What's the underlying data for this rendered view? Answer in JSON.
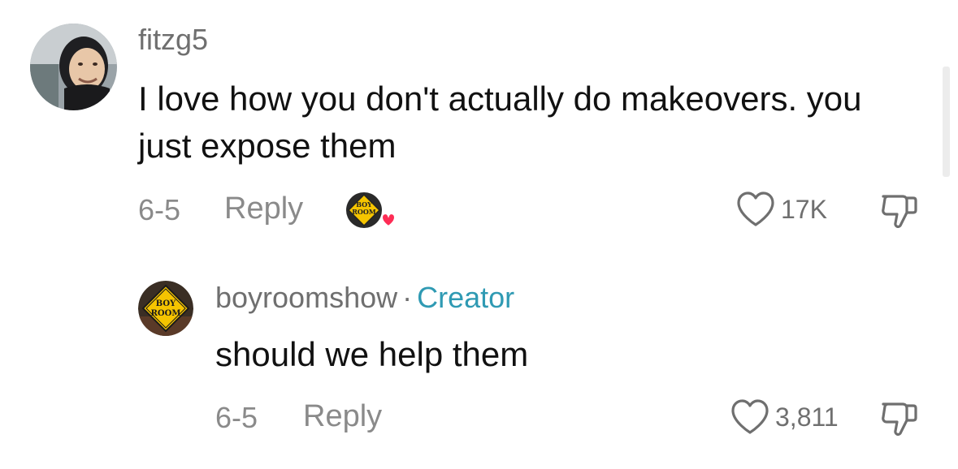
{
  "comment": {
    "username": "fitzg5",
    "text": "I love how you don't actually do makeovers. you just expose them",
    "date": "6-5",
    "reply_label": "Reply",
    "like_count": "17K",
    "avatar_icon": "user-avatar-photo",
    "creator_liked_badge": "creator-liked-icon"
  },
  "reply": {
    "username": "boyroomshow",
    "separator": "·",
    "badge": "Creator",
    "text": "should we help them",
    "date": "6-5",
    "reply_label": "Reply",
    "like_count": "3,811",
    "avatar_sign": "BOY ROOM"
  },
  "colors": {
    "creator_accent": "#2f9ab3",
    "heart_red": "#fe2c55",
    "sign_yellow": "#f5c400"
  }
}
